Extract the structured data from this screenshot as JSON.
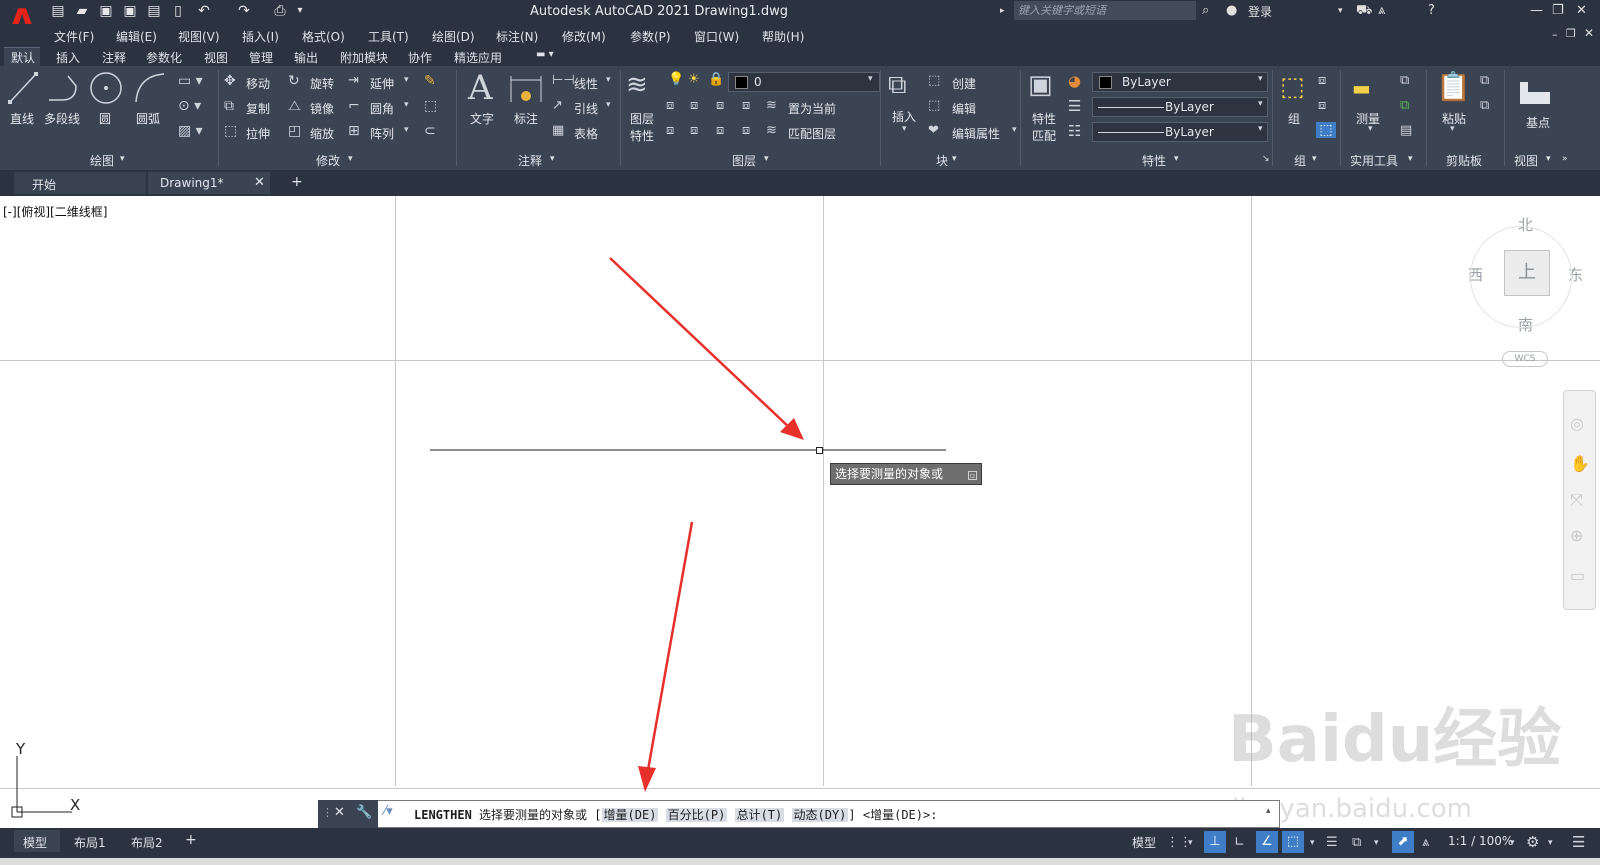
{
  "app": {
    "logo": "A",
    "title": "Autodesk AutoCAD 2021    Drawing1.dwg",
    "search_placeholder": "键入关键字或短语",
    "login": "登录"
  },
  "menu": [
    "文件(F)",
    "编辑(E)",
    "视图(V)",
    "插入(I)",
    "格式(O)",
    "工具(T)",
    "绘图(D)",
    "标注(N)",
    "修改(M)",
    "参数(P)",
    "窗口(W)",
    "帮助(H)"
  ],
  "ribbon_tabs": [
    "默认",
    "插入",
    "注释",
    "参数化",
    "视图",
    "管理",
    "输出",
    "附加模块",
    "协作",
    "精选应用"
  ],
  "ribbon": {
    "draw": {
      "line": "直线",
      "polyline": "多段线",
      "circle": "圆",
      "arc": "圆弧",
      "group": "绘图"
    },
    "modify": {
      "move": "移动",
      "rotate": "旋转",
      "extend": "延伸",
      "copy": "复制",
      "mirror": "镜像",
      "fillet": "圆角",
      "stretch": "拉伸",
      "scale": "缩放",
      "array": "阵列",
      "group": "修改"
    },
    "annotation": {
      "text": "文字",
      "dimension": "标注",
      "linear": "线性",
      "leader": "引线",
      "table": "表格",
      "group": "注释"
    },
    "layers": {
      "props": "图层",
      "props2": "特性",
      "layer_value": "0",
      "set_current": "置为当前",
      "match_layer": "匹配图层",
      "group": "图层"
    },
    "block": {
      "insert": "插入",
      "create": "创建",
      "edit": "编辑",
      "edit_attr": "编辑属性",
      "group": "块"
    },
    "properties": {
      "match": "特性",
      "match2": "匹配",
      "color": "ByLayer",
      "linetype": "ByLayer",
      "lineweight": "ByLayer",
      "group": "特性"
    },
    "groups": {
      "group": "组",
      "group_label": "组"
    },
    "utilities": {
      "measure": "测量",
      "group": "实用工具"
    },
    "clipboard": {
      "paste": "粘贴",
      "group": "剪贴板"
    },
    "view": {
      "base": "基点",
      "group": "视图"
    }
  },
  "doc_tabs": {
    "start": "开始",
    "drawing": "Drawing1*"
  },
  "canvas": {
    "view_label": "[-][俯视][二维线框]",
    "compass": {
      "north": "北",
      "south": "南",
      "east": "东",
      "west": "西",
      "top": "上"
    },
    "wcs": "WCS",
    "ucs_x": "X",
    "ucs_y": "Y",
    "tooltip": "选择要测量的对象或"
  },
  "command_line": {
    "command": "LENGTHEN",
    "prompt": "选择要测量的对象或",
    "bracket_open": "[",
    "options": [
      "增量(DE)",
      "百分比(P)",
      "总计(T)",
      "动态(DY)"
    ],
    "bracket_close": "]",
    "default": "<增量(DE)>:"
  },
  "status_tabs": [
    "模型",
    "布局1",
    "布局2"
  ],
  "status": {
    "model": "模型",
    "scale": "1:1 / 100%"
  },
  "watermark": {
    "brand": "Baidu经验",
    "url": "jingyan.baidu.com"
  },
  "colors": {
    "accent": "#e5231b",
    "ribbon_bg": "#3b4453",
    "bar_bg": "#2b3240",
    "arrow": "#e8302b"
  }
}
